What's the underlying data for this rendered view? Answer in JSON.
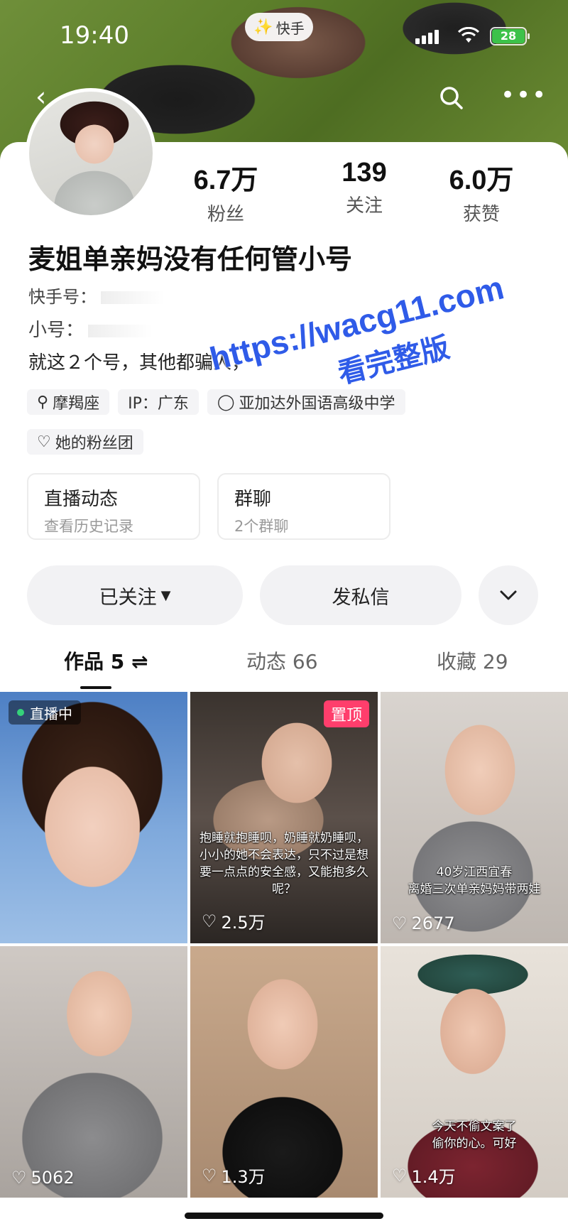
{
  "status_bar": {
    "time": "19:40",
    "app_name": "快手",
    "battery": "28"
  },
  "nav": {
    "back_icon": "chevron-left-icon",
    "search_icon": "search-icon",
    "more_icon": "more-icon"
  },
  "profile": {
    "stats": [
      {
        "value": "6.7万",
        "label": "粉丝"
      },
      {
        "value": "139",
        "label": "关注"
      },
      {
        "value": "6.0万",
        "label": "获赞"
      }
    ],
    "name": "麦姐单亲妈没有任何管小号",
    "kuaishou_id_label": "快手号：",
    "alt_account_label": "小号：",
    "bio": "就这２个号，其他都骗人，",
    "tags": [
      "摩羯座",
      "IP：广东",
      "亚加达外国语高级中学"
    ],
    "fan_group": "她的粉丝团"
  },
  "entries": [
    {
      "title": "直播动态",
      "subtitle": "查看历史记录"
    },
    {
      "title": "群聊",
      "subtitle": "2个群聊"
    }
  ],
  "actions": {
    "follow": "已关注",
    "message": "发私信"
  },
  "tabs": [
    {
      "label": "作品 5",
      "active": true
    },
    {
      "label": "动态 66",
      "active": false
    },
    {
      "label": "收藏 29",
      "active": false
    }
  ],
  "watermark": {
    "line1": "https://wacg11.com",
    "line2": "看完整版"
  },
  "videos": [
    {
      "likes": "",
      "badge": "直播中",
      "caption": ""
    },
    {
      "likes": "2.5万",
      "badge": "置顶",
      "caption": "抱睡就抱睡呗，奶睡就奶睡呗，小小的她不会表达，只不过是想要一点点的安全感，又能抱多久呢？"
    },
    {
      "likes": "2677",
      "badge": "",
      "caption": "40岁江西宜春\n离婚三次单亲妈妈带两娃"
    },
    {
      "likes": "5062",
      "badge": "",
      "caption": ""
    },
    {
      "likes": "1.3万",
      "badge": "",
      "caption": ""
    },
    {
      "likes": "1.4万",
      "badge": "",
      "caption": "今天不偷文案了\n偷你的心。可好"
    }
  ],
  "colors": {
    "accent_pink": "#ff3e6c",
    "live_green": "#35d27a",
    "watermark_blue": "#2f5be8",
    "brand_orange": "#ff5000"
  }
}
